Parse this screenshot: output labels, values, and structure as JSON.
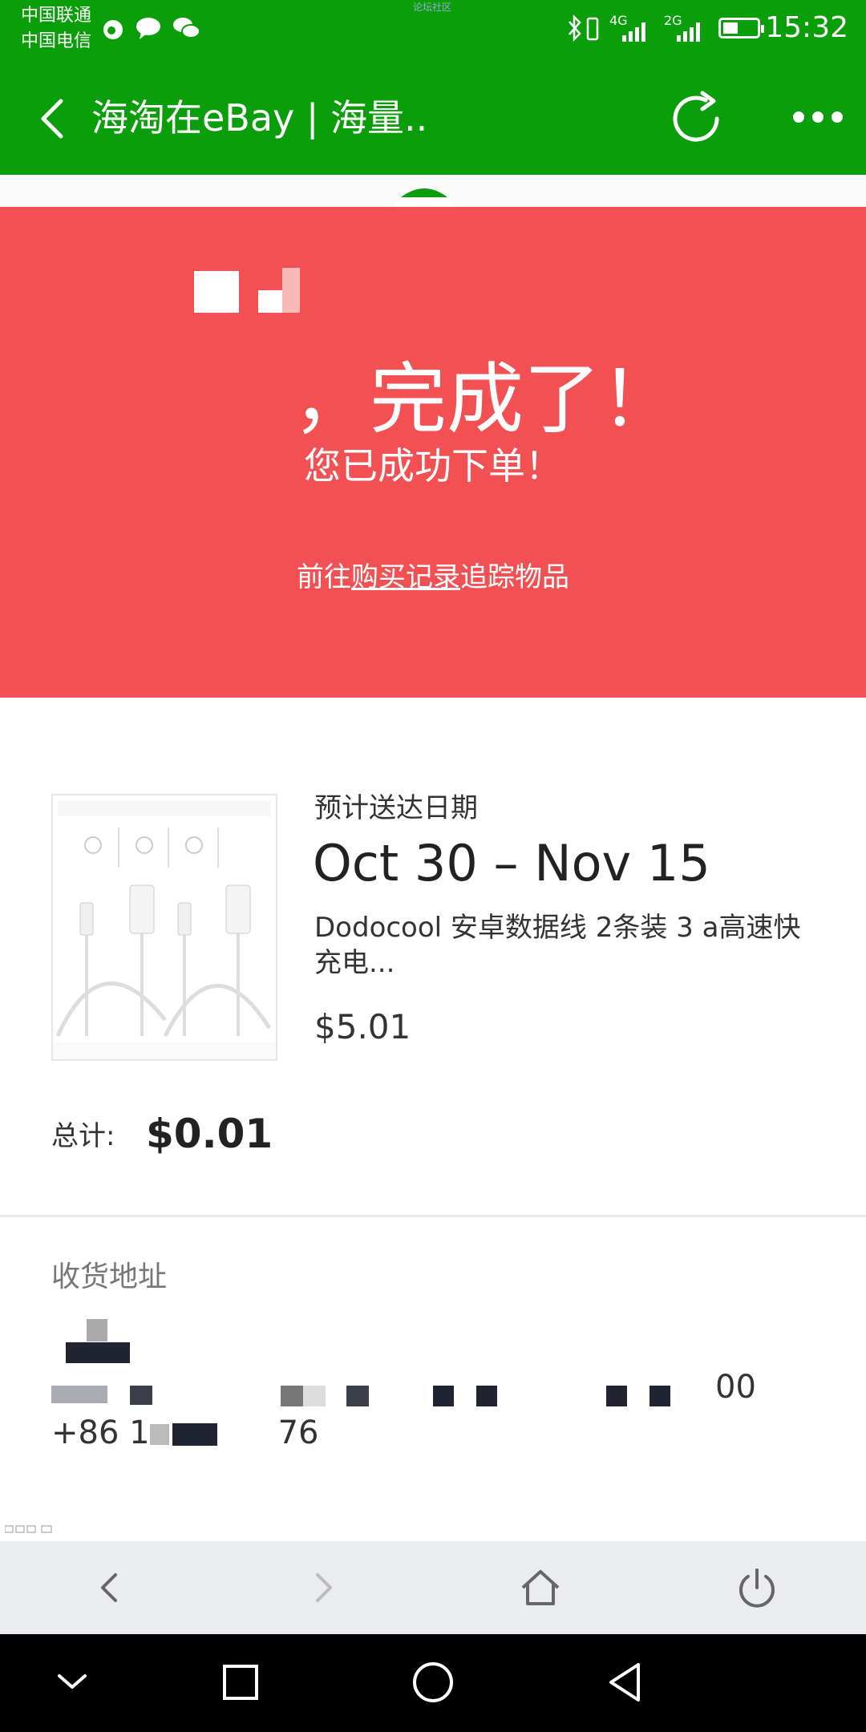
{
  "status_bar": {
    "carrier_1": "中国联通",
    "carrier_2": "中国电信",
    "tiny_link": "论坛社区",
    "net_1": "4G",
    "net_2": "2G",
    "time": "15:32"
  },
  "title_bar": {
    "title": "海淘在eBay | 海量..",
    "icons": [
      "back-arrow-icon",
      "refresh-icon",
      "more-icon"
    ]
  },
  "banner": {
    "headline_suffix": "，完成了！",
    "subtitle": "您已成功下单！",
    "track_prefix": "前往",
    "track_link": "购买记录",
    "track_suffix": "追踪物品"
  },
  "order": {
    "delivery_label": "预计送达日期",
    "delivery_date": "Oct 30 – Nov 15",
    "item_title": "Dodocool 安卓数据线 2条装 3 a高速快充电...",
    "item_price": "$5.01",
    "total_label": "总计:",
    "total_value": "$0.01"
  },
  "address": {
    "label": "收货地址",
    "line1_end": "00",
    "phone_prefix": "+86 1",
    "phone_suffix": "76"
  },
  "toolbar": {
    "icons": [
      "back-icon",
      "forward-icon",
      "home-icon",
      "power-icon"
    ]
  },
  "navbar": {
    "icons": [
      "collapse-icon",
      "recents-icon",
      "home-circle-icon",
      "back-triangle-icon"
    ]
  },
  "colors": {
    "green": "#0a9e0a",
    "red": "#f25052",
    "toolbar_bg": "#eaecef"
  }
}
